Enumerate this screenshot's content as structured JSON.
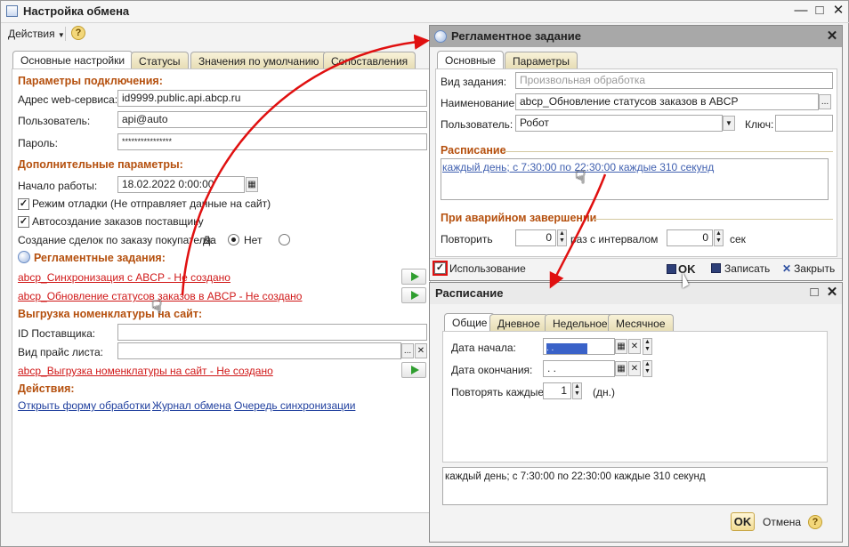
{
  "main_window": {
    "title": "Настройка обмена",
    "actions_menu": "Действия",
    "tabs": [
      "Основные настройки",
      "Статусы",
      "Значения по умолчанию",
      "Сопоставления"
    ],
    "connection_section": "Параметры подключения:",
    "service_address_label": "Адрес web-сервиса:",
    "service_address_value": "id9999.public.api.abcp.ru",
    "user_label": "Пользователь:",
    "user_value": "api@auto",
    "password_label": "Пароль:",
    "password_value": "****************",
    "additional_section": "Дополнительные параметры:",
    "start_label": "Начало работы:",
    "start_value": "18.02.2022  0:00:00",
    "debug_mode": "Режим отладки (Не отправляет данные на сайт)",
    "debug_checked": true,
    "auto_orders": "Автосоздание заказов поставщику",
    "auto_orders_checked": true,
    "deals_label": "Создание сделок по заказу покупателя:",
    "deals_yes": "Да",
    "deals_no": "Нет",
    "deals_selected": "Да",
    "scheduled_section": "Регламентные задания:",
    "task1": "abcp_Синхронизация с ABCP - Не создано",
    "task2": "abcp_Обновление статусов заказов в ABCP - Не создано",
    "export_section": "Выгрузка номенклатуры на сайт:",
    "supplier_id_label": "ID Поставщика:",
    "price_type_label": "Вид прайс листа:",
    "task3": "abcp_Выгрузка номенклатуры на сайт - Не создано",
    "actions_section": "Действия:",
    "links": [
      "Открыть форму обработки",
      "Журнал обмена",
      "Очередь синхронизации"
    ]
  },
  "task_window": {
    "title": "Регламентное задание",
    "tabs": [
      "Основные",
      "Параметры"
    ],
    "task_type_label": "Вид задания:",
    "task_type_value": "Произвольная обработка",
    "name_label": "Наименование:",
    "name_value": "abcp_Обновление статусов заказов в ABCP",
    "user_label": "Пользователь:",
    "user_value": "Робот",
    "key_label": "Ключ:",
    "key_value": "",
    "schedule_section": "Расписание",
    "schedule_link": "каждый день; с 7:30:00 по 22:30:00 каждые 310 секунд",
    "emergency_section": "При аварийном завершении",
    "repeat_label": "Повторить",
    "repeat_value": "0",
    "interval_label": "раз с интервалом",
    "interval_value": "0",
    "interval_unit": "сек",
    "usage_label": "Использование",
    "usage_checked": true,
    "ok": "OK",
    "save": "Записать",
    "close": "Закрыть"
  },
  "schedule_window": {
    "title": "Расписание",
    "tabs": [
      "Общие",
      "Дневное",
      "Недельное",
      "Месячное"
    ],
    "start_date_label": "Дата начала:",
    "start_date_value": " .  .",
    "end_date_label": "Дата окончания:",
    "end_date_value": " .  .",
    "repeat_every_label": "Повторять каждые:",
    "repeat_every_value": "1",
    "repeat_every_unit": "(дн.)",
    "summary": "каждый день; с 7:30:00 по 22:30:00 каждые 310 секунд",
    "ok": "OK",
    "cancel": "Отмена"
  },
  "colors": {
    "section": "#b5500e",
    "red_link": "#d01818",
    "blue_link": "#1f3f9e",
    "arrow": "#e01010"
  }
}
